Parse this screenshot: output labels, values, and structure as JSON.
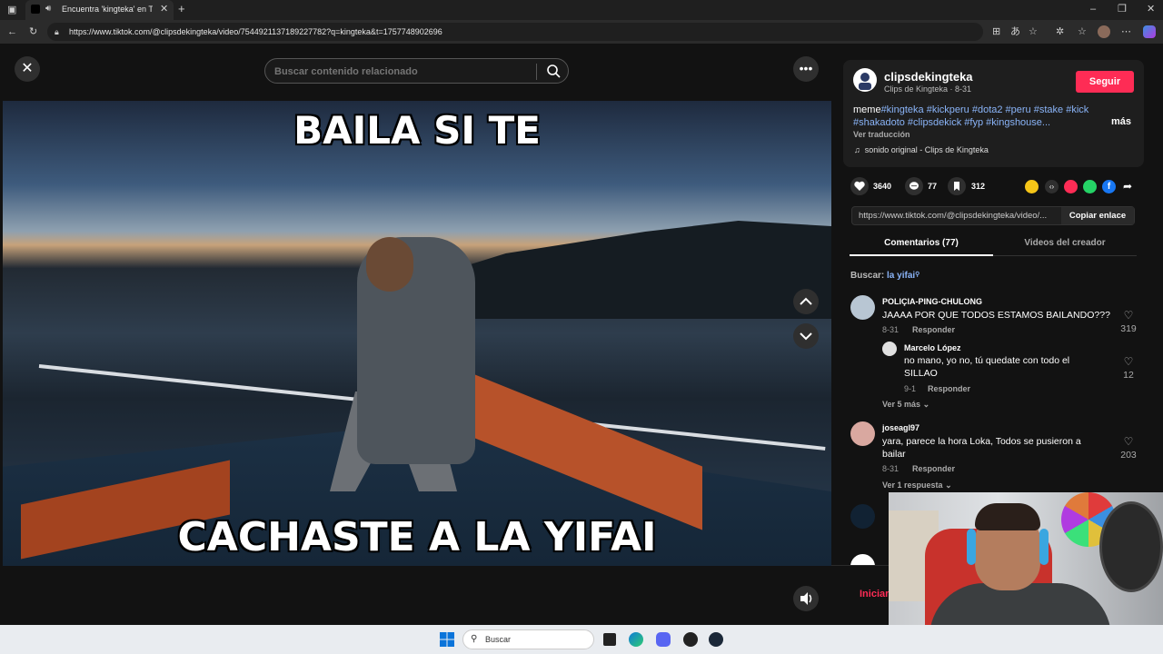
{
  "browser": {
    "tab_title": "Encuentra 'kingteka' en TikTok",
    "url": "https://www.tiktok.com/@clipsdekingteka/video/7544921137189227782?q=kingteka&t=1757748902696"
  },
  "player": {
    "search_placeholder": "Buscar contenido relacionado",
    "caption_top": "BAILA SI TE",
    "caption_bottom": "CACHASTE A LA YIFAI"
  },
  "post": {
    "username": "clipsdekingteka",
    "nickname": "Clips de Kingteka · 8-31",
    "follow_label": "Seguir",
    "desc_prefix": "meme",
    "desc_tags": "#kingteka #kickperu #dota2 #peru #stake #kick #shakadoto #clipsdekick #fyp #kingshouse...",
    "more_label": "más",
    "translate_label": "Ver traducción",
    "sound_label": "sonido original - Clips de Kingteka",
    "likes": "3640",
    "comments": "77",
    "saves": "312",
    "share_link": "https://www.tiktok.com/@clipsdekingteka/video/...",
    "copy_label": "Copiar enlace"
  },
  "tabs": {
    "comments": "Comentarios (77)",
    "videos": "Videos del creador"
  },
  "comment_search": {
    "prefix": "Buscar:",
    "query": "la yifai"
  },
  "comments": [
    {
      "user": "POLIÇIA-PING-CHULONG",
      "text": "JAAAA POR QUE TODOS ESTAMOS BAILANDO???",
      "date": "8-31",
      "reply": "Responder",
      "likes": "319"
    },
    {
      "user": "Marcelo López",
      "text": "no mano, yo no, tú quedate con todo el SILLAO",
      "date": "9-1",
      "reply": "Responder",
      "likes": "12"
    },
    {
      "user": "joseagl97",
      "text": "yara, parece la hora Loka, Todos se pusieron a bailar",
      "date": "8-31",
      "reply": "Responder",
      "likes": "203"
    }
  ],
  "view_more_1": "Ver 5 más",
  "view_more_2": "Ver 1 respuesta",
  "login_label": "Iniciar",
  "taskbar": {
    "search_label": "Buscar"
  }
}
